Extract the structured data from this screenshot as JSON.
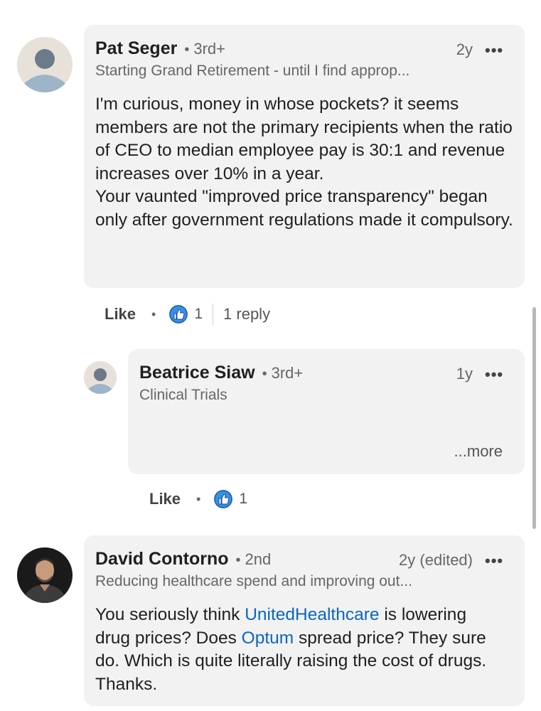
{
  "comments": [
    {
      "name": "Pat Seger",
      "degree": "3rd+",
      "time": "2y",
      "headline": "Starting Grand Retirement - until I find approp...",
      "body": [
        "I'm curious, money in whose pockets?  it seems members are not the primary recipients when the ratio of CEO to median employee pay is 30:1 and revenue increases over 10% in a year.",
        "Your vaunted \"improved price transparency\" began only after government regulations made it compulsory."
      ],
      "like_label": "Like",
      "reaction_count": "1",
      "reply_label": "1 reply",
      "avatar": "default-person-avatar"
    },
    {
      "name": "Beatrice Siaw",
      "degree": "3rd+",
      "time": "1y",
      "headline": "Clinical Trials",
      "see_more": "...more",
      "like_label": "Like",
      "reaction_count": "1",
      "avatar": "default-person-avatar"
    },
    {
      "name": "David Contorno",
      "degree": "2nd",
      "time": "2y (edited)",
      "headline": "Reducing healthcare spend and improving out...",
      "body_parts": {
        "a": "You seriously think ",
        "link1": "UnitedHealthcare",
        "b": " is lowering drug prices?  Does ",
        "link2": "Optum",
        "c": " spread price?  They sure do. Which is quite literally raising the cost of drugs. Thanks."
      },
      "avatar": "profile-photo-avatar"
    }
  ],
  "separator": "•",
  "overflow_icon": "•••",
  "colors": {
    "bubble": "#f2f2f2",
    "link": "#0a66c2",
    "reaction": "#378fe9"
  }
}
